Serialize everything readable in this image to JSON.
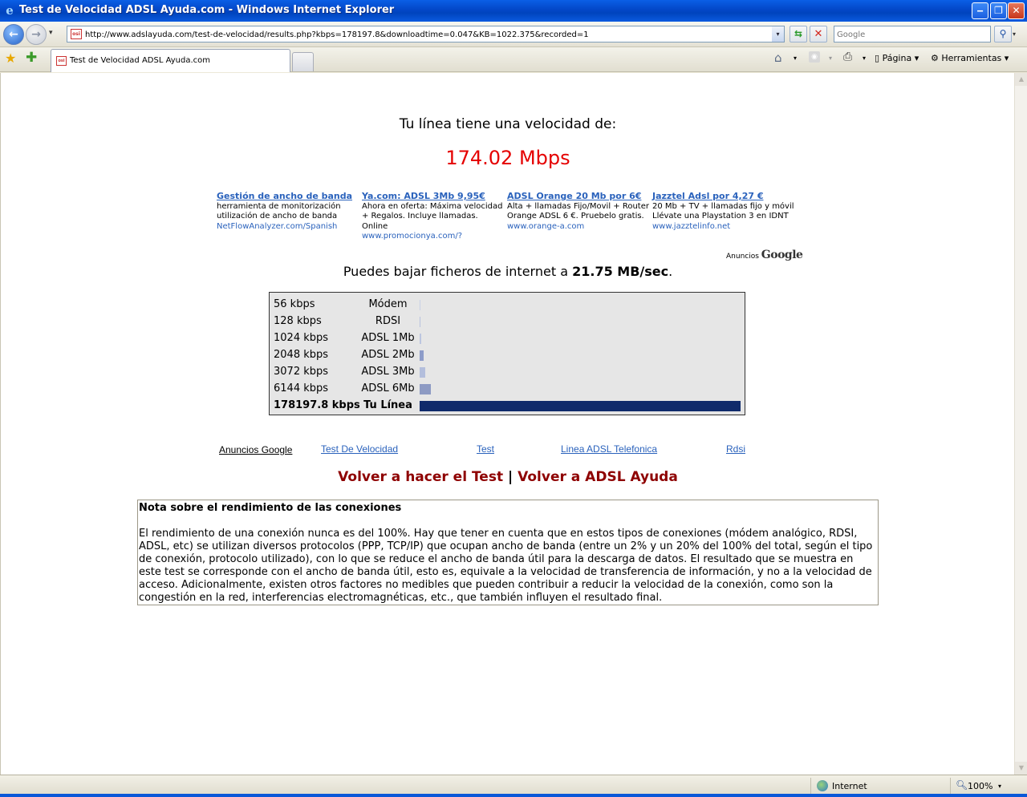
{
  "window": {
    "title": "Test de Velocidad ADSL Ayuda.com - Windows Internet Explorer",
    "min_glyph": "‒",
    "max_glyph": "❐",
    "close_glyph": "✕"
  },
  "address_bar": {
    "url": "http://www.adslayuda.com/test-de-velocidad/results.php?kbps=178197.8&downloadtime=0.047&KB=1022.375&recorded=1",
    "page_icon_text": "osi"
  },
  "search": {
    "placeholder": "Google"
  },
  "tab": {
    "label": "Test de Velocidad ADSL Ayuda.com"
  },
  "commands": {
    "page": "Página",
    "tools": "Herramientas"
  },
  "page": {
    "heading": "Tu línea tiene una velocidad de:",
    "speed": "174.02 Mbps",
    "ads": [
      {
        "title": "Gestión de ancho de banda",
        "text": "herramienta de monitorización utilización de ancho de banda",
        "url": "NetFlowAnalyzer.com/Spanish"
      },
      {
        "title": "Ya.com: ADSL 3Mb 9,95€",
        "text": "Ahora en oferta: Máxima velocidad + Regalos. Incluye llamadas. Online",
        "url": "www.promocionya.com/?"
      },
      {
        "title": "ADSL Orange 20 Mb por 6€",
        "text": "Alta + llamadas Fijo/Movil + Router Orange ADSL 6 €. Pruebelo gratis.",
        "url": "www.orange-a.com"
      },
      {
        "title": "Jazztel Adsl por 4,27 €",
        "text": "20 Mb + TV + llamadas fijo y móvil Llévate una Playstation 3 en IDNT",
        "url": "www.jazztelinfo.net"
      }
    ],
    "ads_label": "Anuncios",
    "ads_brand": "Google",
    "download_prefix": "Puedes bajar ficheros de internet a",
    "download_speed": "21.75 MB/sec",
    "download_suffix": ".",
    "speed_rows": [
      {
        "kbps": "56 kbps",
        "type": "Módem",
        "kbps_value": 56,
        "color": "#c8d0e6"
      },
      {
        "kbps": "128 kbps",
        "type": "RDSI",
        "kbps_value": 128,
        "color": "#b8c2de"
      },
      {
        "kbps": "1024 kbps",
        "type": "ADSL 1Mb",
        "kbps_value": 1024,
        "color": "#bcc6e0"
      },
      {
        "kbps": "2048 kbps",
        "type": "ADSL 2Mb",
        "kbps_value": 2048,
        "color": "#8d9cc9"
      },
      {
        "kbps": "3072 kbps",
        "type": "ADSL 3Mb",
        "kbps_value": 3072,
        "color": "#b3bedc"
      },
      {
        "kbps": "6144 kbps",
        "type": "ADSL 6Mb",
        "kbps_value": 6144,
        "color": "#8d9ac3"
      },
      {
        "kbps": "178197.8 kbps",
        "type": "Tu Línea",
        "kbps_value": 178197.8,
        "color": "#0f2a6b"
      }
    ],
    "links": {
      "ads_google": "Anuncios Google",
      "test_velocidad": "Test De Velocidad",
      "test": "Test",
      "adsl_telefonica": "Linea ADSL Telefonica",
      "rdsi": "Rdsi"
    },
    "retest": "Volver a hacer el Test",
    "separator": "|",
    "back_home": "Volver a ADSL Ayuda",
    "note_title": "Nota sobre el rendimiento de las conexiones",
    "note_text": "El rendimiento de una conexión nunca es del 100%. Hay que tener en cuenta que en estos tipos de conexiones (módem analógico, RDSI, ADSL, etc) se utilizan diversos protocolos (PPP, TCP/IP) que ocupan ancho de banda (entre un 2% y un 20% del 100% del total, según el tipo de conexión, protocolo utilizado), con lo que se reduce el ancho de banda útil para la descarga de datos. El resultado que se muestra en este test se corresponde con el ancho de banda útil, esto es, equivale a la velocidad de transferencia de información, y no a la velocidad de acceso. Adicionalmente, existen otros factores no medibles que pueden contribuir a reducir la velocidad de la conexión, como son la congestión en la red, interferencias electromagnéticas, etc., que también influyen el resultado final."
  },
  "status": {
    "zone": "Internet",
    "zoom": "100%"
  },
  "icons": {
    "back": "←",
    "forward": "→",
    "go": "⇆",
    "stop": "✕",
    "search": "⚲",
    "favorites": "★",
    "add_favorite": "✚",
    "home": "⌂",
    "feeds": "◉",
    "print": "⎙",
    "dropdown": "▾",
    "scroll_up": "▲",
    "scroll_down": "▼",
    "ie": "e"
  }
}
